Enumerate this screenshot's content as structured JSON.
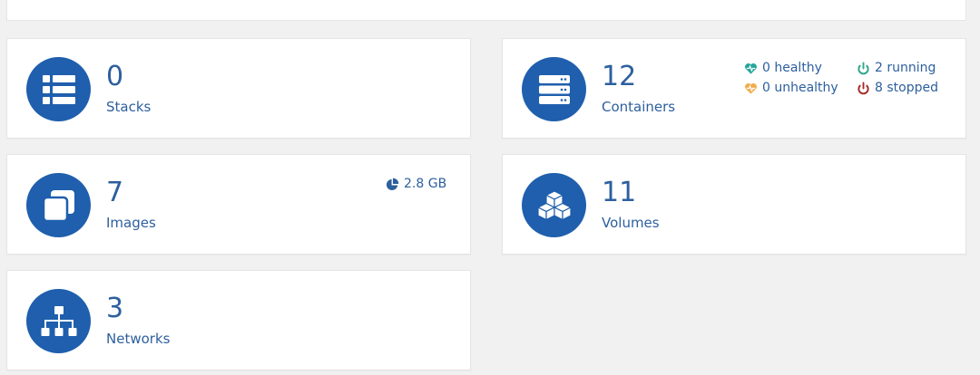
{
  "tiles": {
    "stacks": {
      "value": "0",
      "label": "Stacks",
      "icon": "stacks-icon"
    },
    "containers": {
      "value": "12",
      "label": "Containers",
      "icon": "containers-icon",
      "stats": {
        "healthy": "0 healthy",
        "unhealthy": "0 unhealthy",
        "running": "2 running",
        "stopped": "8 stopped"
      }
    },
    "images": {
      "value": "7",
      "label": "Images",
      "icon": "images-icon",
      "size": "2.8 GB"
    },
    "volumes": {
      "value": "11",
      "label": "Volumes",
      "icon": "volumes-icon"
    },
    "networks": {
      "value": "3",
      "label": "Networks",
      "icon": "networks-icon"
    }
  },
  "colors": {
    "accent": "#1f5fad",
    "text": "#2d5f9e",
    "healthy": "#26a69a",
    "unhealthy": "#f0ad4e",
    "running": "#2ea58a",
    "stopped": "#a52a2a"
  }
}
